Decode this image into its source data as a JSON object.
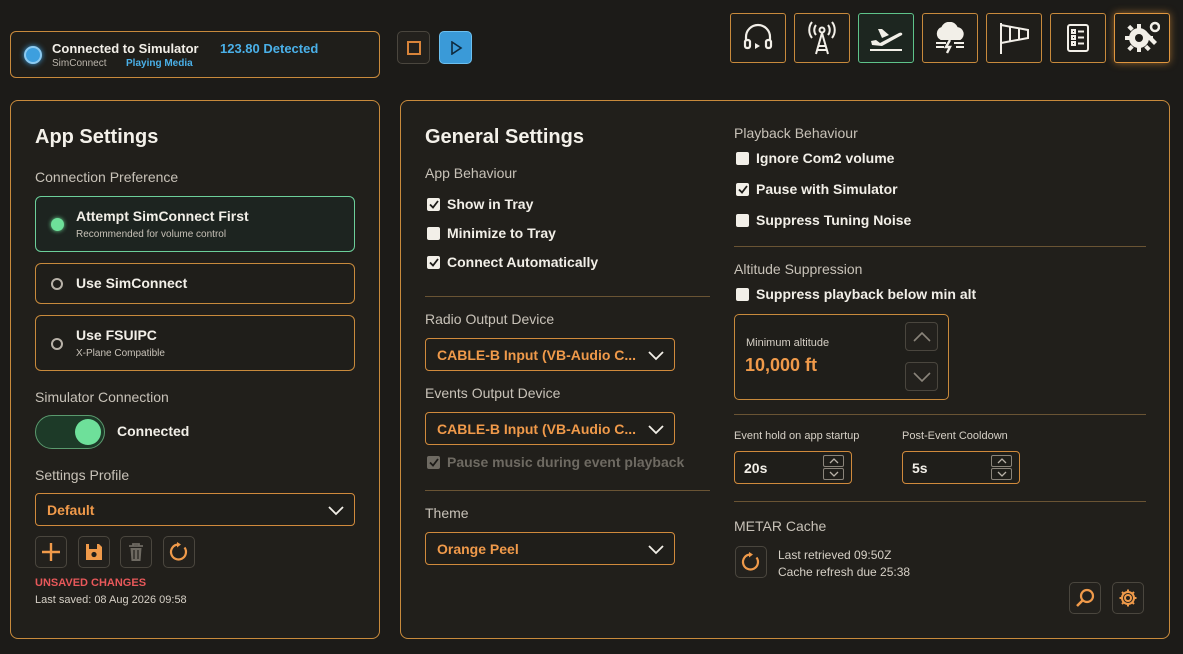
{
  "status": {
    "title": "Connected to Simulator",
    "detected": "123.80 Detected",
    "source": "SimConnect",
    "media": "Playing Media"
  },
  "nav": {
    "items": [
      {
        "icon": "headset-icon"
      },
      {
        "icon": "radio-tower-icon"
      },
      {
        "icon": "plane-takeoff-icon"
      },
      {
        "icon": "weather-storm-icon"
      },
      {
        "icon": "windsock-icon"
      },
      {
        "icon": "checklist-icon"
      },
      {
        "icon": "gear-wrench-icon"
      }
    ]
  },
  "app_settings": {
    "title": "App Settings",
    "connection_preference_label": "Connection Preference",
    "options": [
      {
        "title": "Attempt SimConnect First",
        "subtitle": "Recommended for volume control",
        "selected": true
      },
      {
        "title": "Use SimConnect",
        "subtitle": "",
        "selected": false
      },
      {
        "title": "Use FSUIPC",
        "subtitle": "X-Plane Compatible",
        "selected": false
      }
    ],
    "simulator_connection_label": "Simulator Connection",
    "toggle_label": "Connected",
    "settings_profile_label": "Settings Profile",
    "profile_value": "Default",
    "unsaved": "UNSAVED CHANGES",
    "last_saved": "Last saved: 08 Aug 2026 09:58"
  },
  "general_settings": {
    "title": "General Settings",
    "app_behaviour_label": "App Behaviour",
    "show_in_tray": "Show in Tray",
    "minimize_to_tray": "Minimize to Tray",
    "connect_automatically": "Connect Automatically",
    "radio_output_label": "Radio Output Device",
    "radio_output_value": "CABLE-B Input (VB-Audio C...",
    "events_output_label": "Events Output Device",
    "events_output_value": "CABLE-B Input (VB-Audio C...",
    "pause_music": "Pause music during event playback",
    "theme_label": "Theme",
    "theme_value": "Orange Peel"
  },
  "playback": {
    "label": "Playback Behaviour",
    "ignore_com2": "Ignore Com2 volume",
    "pause_with_sim": "Pause with Simulator",
    "suppress_tuning": "Suppress Tuning Noise"
  },
  "altitude": {
    "label": "Altitude Suppression",
    "suppress_below": "Suppress playback below min alt",
    "min_label": "Minimum altitude",
    "min_value": "10,000 ft"
  },
  "timing": {
    "hold_label": "Event hold on app startup",
    "hold_value": "20s",
    "cooldown_label": "Post-Event Cooldown",
    "cooldown_value": "5s"
  },
  "metar": {
    "label": "METAR Cache",
    "last_retrieved": "Last retrieved 09:50Z",
    "refresh_due": "Cache refresh due 25:38"
  },
  "colors": {
    "accent": "#c88a3c",
    "orange_text": "#f09a4a",
    "blue": "#3d9fde",
    "green": "#6ee09a",
    "red": "#e8585a"
  }
}
